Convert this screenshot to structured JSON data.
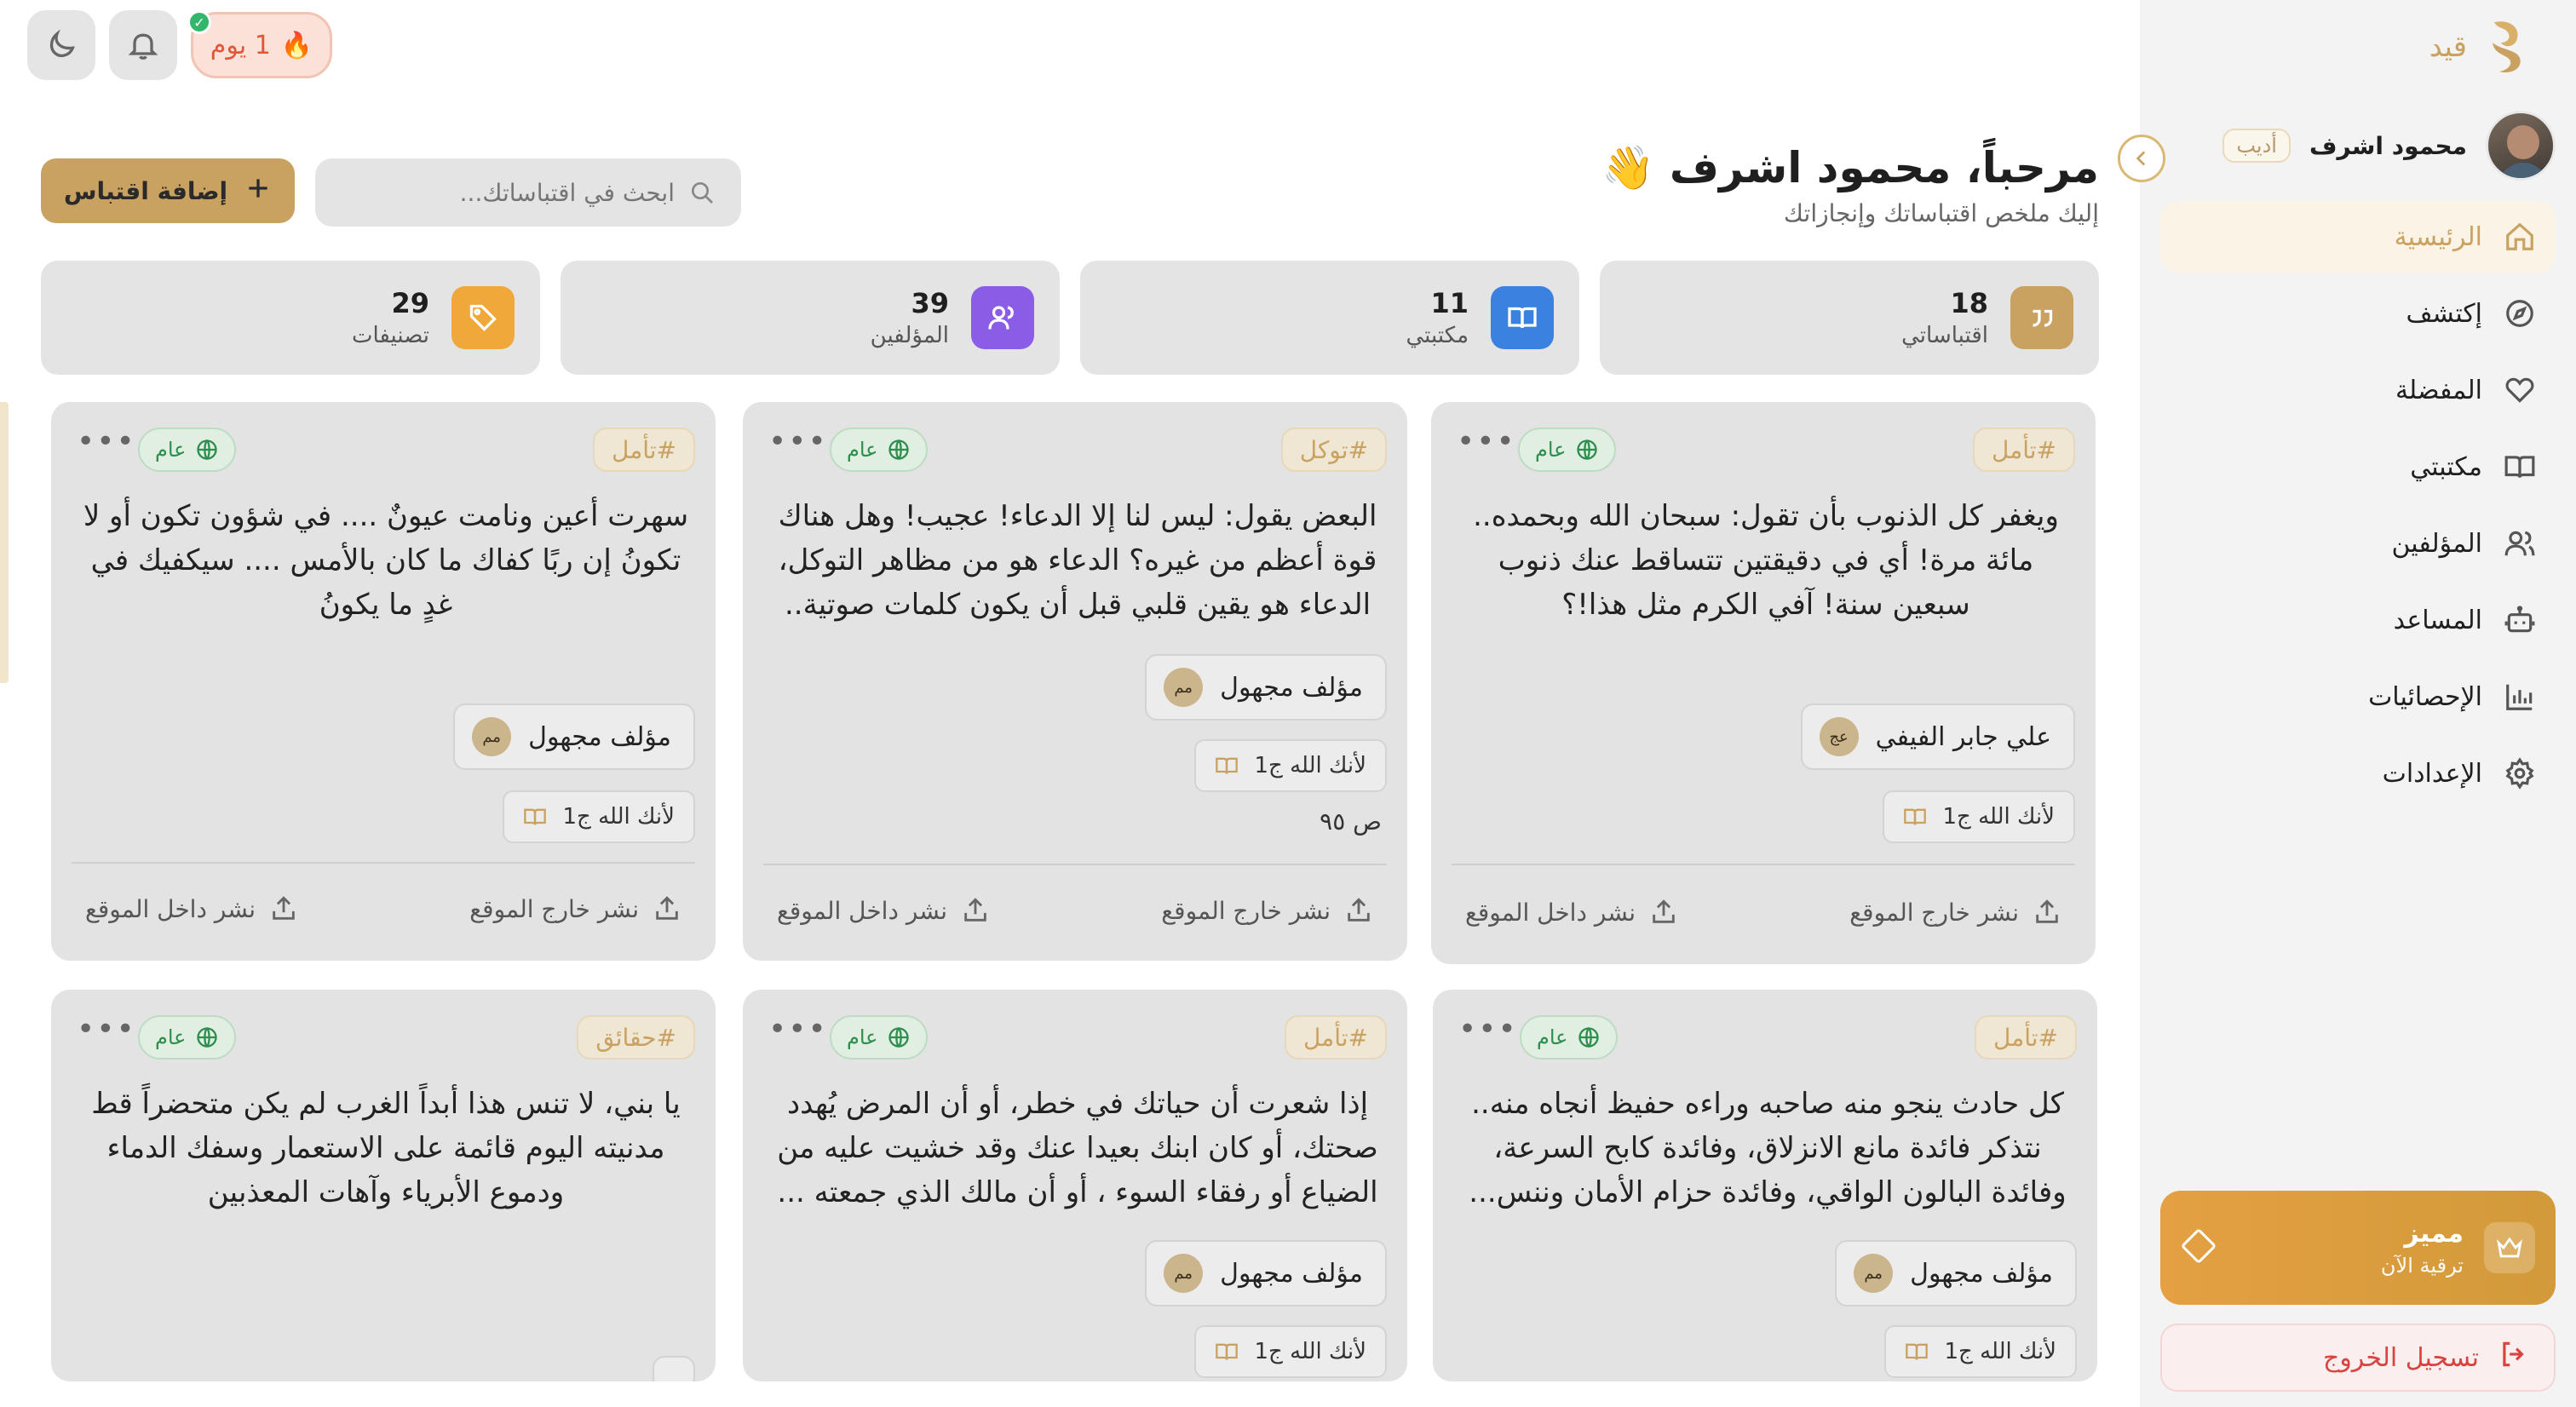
{
  "sidebar": {
    "brand": "قيد",
    "user": {
      "name": "محمود اشرف",
      "role": "أديب"
    },
    "nav": [
      {
        "label": "الرئيسية",
        "icon": "home-icon",
        "active": true
      },
      {
        "label": "إكتشف",
        "icon": "compass-icon"
      },
      {
        "label": "المفضلة",
        "icon": "heart-icon"
      },
      {
        "label": "مكتبتي",
        "icon": "book-open-icon"
      },
      {
        "label": "المؤلفين",
        "icon": "users-icon"
      },
      {
        "label": "المساعد",
        "icon": "bot-icon"
      },
      {
        "label": "الإحصائيات",
        "icon": "bar-chart-icon"
      },
      {
        "label": "الإعدادات",
        "icon": "gear-icon"
      }
    ],
    "premium": {
      "title": "مميز",
      "subtitle": "ترقية الآن"
    },
    "logout": "تسجيل الخروج"
  },
  "topbar": {
    "streak": "1 يوم",
    "streak_icon": "🔥"
  },
  "header": {
    "greeting": "مرحباً، محمود اشرف 👋",
    "subtitle": "إليك ملخص اقتباساتك وإنجازاتك",
    "search_placeholder": "ابحث في اقتباساتك...",
    "add_label": "إضافة اقتباس"
  },
  "stats": [
    {
      "value": "18",
      "label": "اقتباساتي",
      "color": "#c9a262",
      "icon": "quote-icon"
    },
    {
      "value": "11",
      "label": "مكتبتي",
      "color": "#3b82e0",
      "icon": "book-open-icon"
    },
    {
      "value": "39",
      "label": "المؤلفين",
      "color": "#8b5ce6",
      "icon": "users-icon"
    },
    {
      "value": "29",
      "label": "تصنيفات",
      "color": "#f0a83a",
      "icon": "tag-icon"
    }
  ],
  "common": {
    "visibility": "عام",
    "share_out": "نشر خارج الموقع",
    "share_in": "نشر داخل الموقع"
  },
  "cards": [
    {
      "tag": "#تأمل",
      "quote": "ويغفر كل الذنوب بأن تقول: سبحان الله وبحمده.. مائة مرة! أي في دقيقتين تتساقط عنك ذنوب سبعين سنة! آفي الكرم مثل هذا!؟",
      "author": "علي جابر الفيفي",
      "initials": "عج",
      "book": "لأنك الله ج1",
      "page": ""
    },
    {
      "tag": "#توكل",
      "quote": "البعض يقول: ليس لنا إلا الدعاء! عجيب! وهل هناك قوة أعظم من غيره؟ الدعاء هو من مظاهر التوكل، الدعاء هو يقين قلبي قبل أن يكون كلمات صوتية..",
      "author": "مؤلف مجهول",
      "initials": "مم",
      "book": "لأنك الله ج1",
      "page": "ص ٩٥"
    },
    {
      "tag": "#تأمل",
      "quote": "سهرت أعين ونامت عيونٌ .... في شؤون تكون أو لا تكونُ إن ربًا كفاك ما كان بالأمس .... سيكفيك في غدٍ ما يكونُ",
      "author": "مؤلف مجهول",
      "initials": "مم",
      "book": "لأنك الله ج1",
      "page": ""
    },
    {
      "tag": "#تأمل",
      "quote": "كل حادث ينجو منه صاحبه وراءه حفيظ أنجاه منه.. نتذكر فائدة مانع الانزلاق، وفائدة كابح السرعة، وفائدة البالون الواقي، وفائدة حزام الأمان وننس...",
      "author": "مؤلف مجهول",
      "initials": "مم",
      "book": "لأنك الله ج1",
      "page": ""
    },
    {
      "tag": "#تأمل",
      "quote": "إذا شعرت أن حياتك في خطر، أو أن المرض يُهدد صحتك، أو كان ابنك بعيدا عنك وقد خشيت عليه من الضياع أو رفقاء السوء ، أو أن مالك الذي جمعته ...",
      "author": "مؤلف مجهول",
      "initials": "مم",
      "book": "لأنك الله ج1",
      "page": ""
    },
    {
      "tag": "#حقائق",
      "quote": "يا بني، لا تنس هذا أبداً الغرب لم يكن متحضراً قط مدنيته اليوم قائمة على الاستعمار وسفك الدماء ودموع الأبرياء وآهات المعذبين",
      "author": "",
      "initials": "",
      "book": "",
      "page": ""
    }
  ]
}
